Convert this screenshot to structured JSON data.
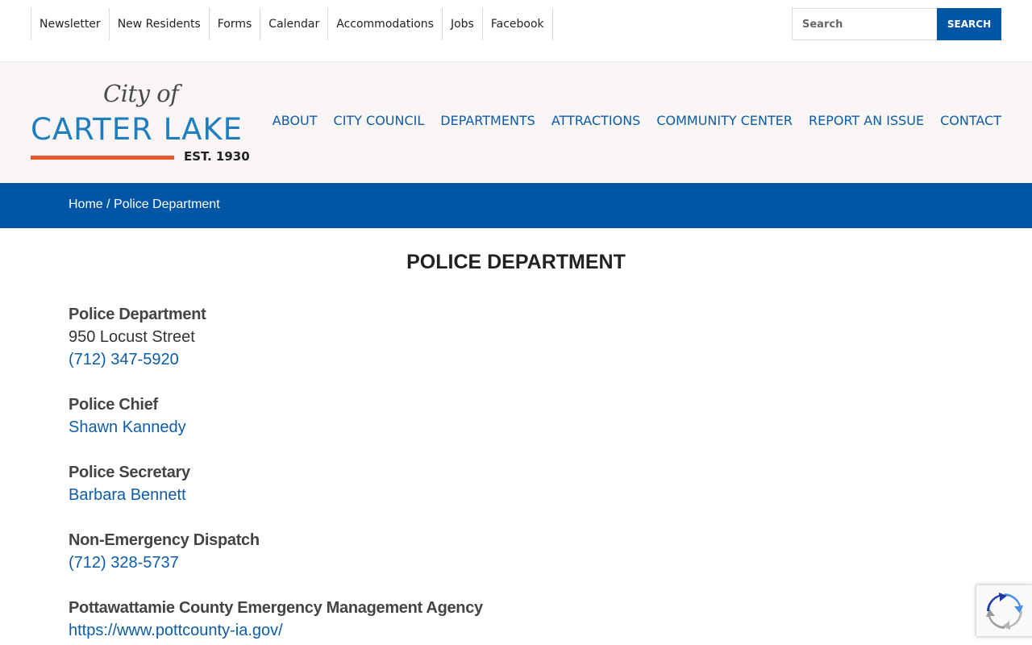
{
  "utility_nav": {
    "links": [
      "Newsletter",
      "New Residents",
      "Forms",
      "Calendar",
      "Accommodations",
      "Jobs",
      "Facebook"
    ],
    "search_placeholder": "Search",
    "search_button": "SEARCH"
  },
  "logo": {
    "city_of": "City of",
    "name": "CARTER LAKE",
    "established": "EST. 1930"
  },
  "main_nav": [
    "ABOUT",
    "CITY COUNCIL",
    "DEPARTMENTS",
    "ATTRACTIONS",
    "COMMUNITY CENTER",
    "REPORT AN ISSUE",
    "CONTACT"
  ],
  "breadcrumb": {
    "home": "Home",
    "separator": " / ",
    "current": "Police Department"
  },
  "page_title": "POLICE DEPARTMENT",
  "sections": [
    {
      "label": "Police Department",
      "text": "950 Locust Street",
      "link": "(712) 347-5920"
    },
    {
      "label": "Police Chief",
      "link": "Shawn Kannedy"
    },
    {
      "label": "Police Secretary",
      "link": "Barbara Bennett"
    },
    {
      "label": "Non-Emergency Dispatch",
      "link": "(712) 328-5737"
    },
    {
      "label": "Pottawattamie County Emergency Management Agency",
      "link": "https://www.pottcounty-ia.gov/"
    }
  ],
  "colors": {
    "brand_blue": "#0055a5",
    "link_blue": "#0e5ca7",
    "logo_orange": "#e45a2b"
  }
}
